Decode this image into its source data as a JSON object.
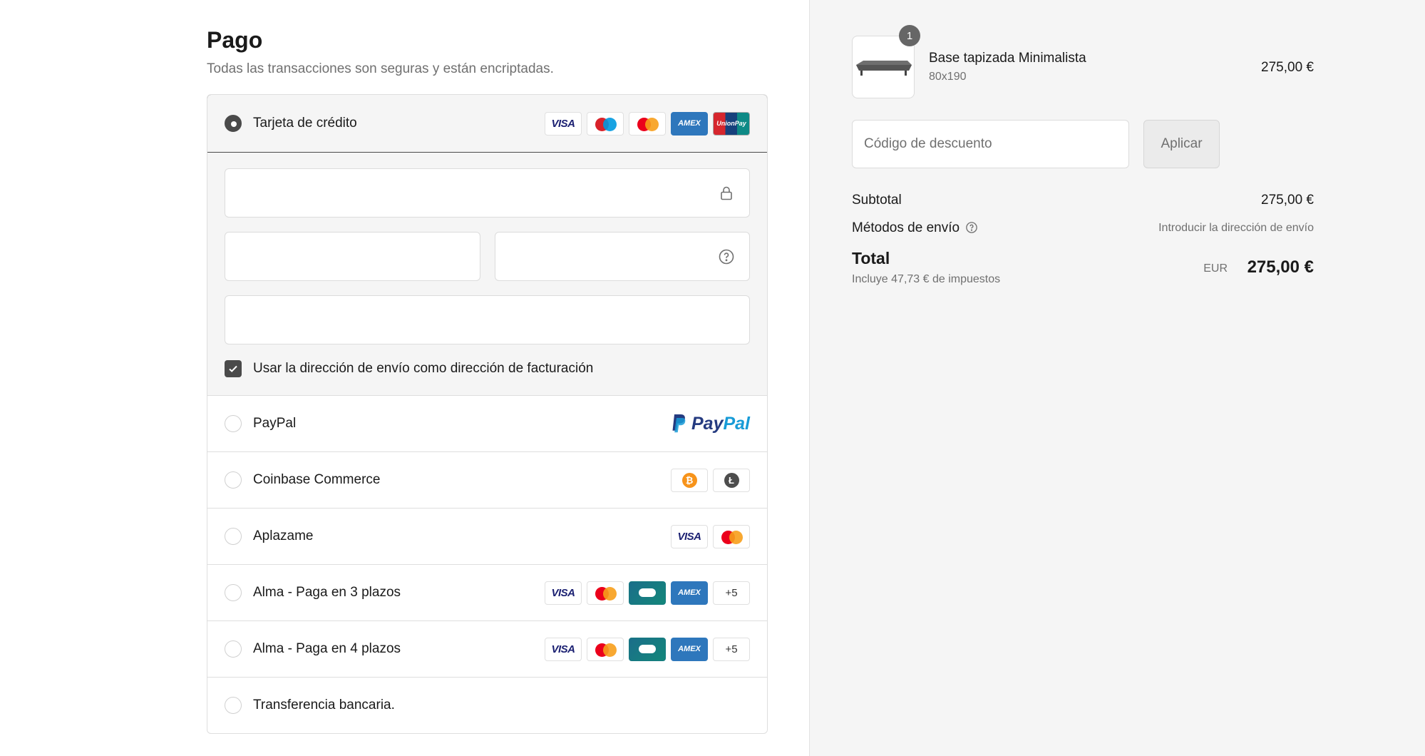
{
  "payment": {
    "title": "Pago",
    "subtitle": "Todas las transacciones son seguras y están encriptadas.",
    "options": [
      {
        "label": "Tarjeta de crédito",
        "selected": true
      },
      {
        "label": "PayPal",
        "selected": false
      },
      {
        "label": "Coinbase Commerce",
        "selected": false
      },
      {
        "label": "Aplazame",
        "selected": false
      },
      {
        "label": "Alma - Paga en 3 plazos",
        "selected": false
      },
      {
        "label": "Alma - Paga en 4 plazos",
        "selected": false
      },
      {
        "label": "Transferencia bancaria.",
        "selected": false
      }
    ],
    "card_brands": {
      "visa": "VISA",
      "amex": "AMEX",
      "unionpay": "UnionPay",
      "more": "+5"
    },
    "paypal_logo": {
      "pay": "Pay",
      "pal": "Pal"
    },
    "crypto": {
      "bitcoin": "₿",
      "litecoin": "Ł"
    },
    "billing_checkbox": {
      "label": "Usar la dirección de envío como dirección de facturación",
      "checked": true
    },
    "icons": {
      "lock": "lock-icon",
      "help": "help-circle-icon",
      "check": "check-icon"
    }
  },
  "order": {
    "product": {
      "name": "Base tapizada Minimalista",
      "variant": "80x190",
      "price": "275,00 €",
      "quantity": "1"
    },
    "discount": {
      "placeholder": "Código de descuento",
      "button": "Aplicar"
    },
    "subtotal": {
      "label": "Subtotal",
      "value": "275,00 €"
    },
    "shipping": {
      "label": "Métodos de envío",
      "value": "Introducir la dirección de envío"
    },
    "total": {
      "label": "Total",
      "tax_note": "Incluye 47,73 € de impuestos",
      "currency": "EUR",
      "value": "275,00 €"
    }
  },
  "colors": {
    "accent": "#4a4a4a",
    "sidebar_bg": "#f5f5f5",
    "paypal_dark": "#253b80",
    "paypal_light": "#179bd7",
    "bitcoin": "#f7931a",
    "litecoin": "#4d4d4d"
  }
}
